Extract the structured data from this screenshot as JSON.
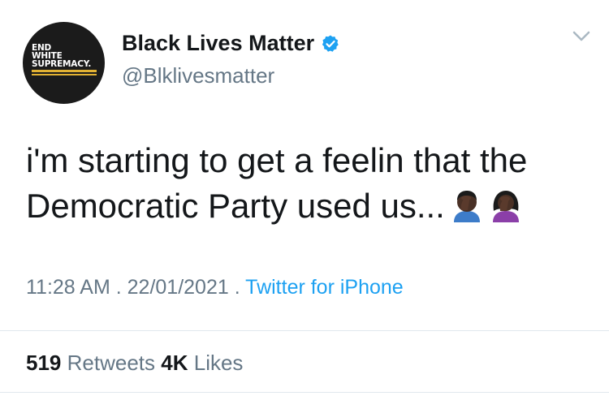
{
  "profile": {
    "avatar_lines": [
      "END",
      "WHITE",
      "SUPREMACY."
    ],
    "display_name": "Black Lives Matter",
    "handle": "@Blklivesmatter",
    "verified": true
  },
  "tweet": {
    "text_line1": "i'm starting to get a feelin that the",
    "text_line2": "Democratic Party used us...",
    "emojis": [
      "man-facepalming-icon",
      "woman-facepalming-icon"
    ],
    "time": "11:28 AM",
    "sep1": ".",
    "date": "22/01/2021",
    "sep2": ".",
    "source": "Twitter for iPhone"
  },
  "stats": {
    "retweets_count": "519",
    "retweets_label": "Retweets",
    "likes_count": "4K",
    "likes_label": "Likes"
  },
  "colors": {
    "link_blue": "#1da1f2",
    "secondary_gray": "#657786",
    "avatar_accent": "#e2b233"
  }
}
